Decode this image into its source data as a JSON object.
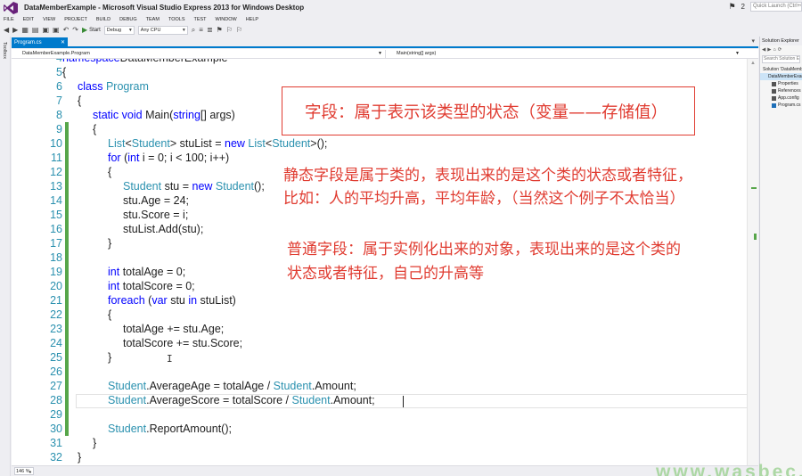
{
  "window": {
    "title": "DataMemberExample - Microsoft Visual Studio Express 2013 for Windows Desktop",
    "notifications": "2",
    "quick_launch_placeholder": "Quick Launch (Ctrl+Q)"
  },
  "menu": [
    "FILE",
    "EDIT",
    "VIEW",
    "PROJECT",
    "BUILD",
    "DEBUG",
    "TEAM",
    "TOOLS",
    "TEST",
    "WINDOW",
    "HELP"
  ],
  "toolbar": {
    "start_label": "Start",
    "config_value": "Debug",
    "platform_value": "Any CPU"
  },
  "toolbox_label": "Toolbox",
  "tab": {
    "label": "Program.cs",
    "pin": "⊧",
    "close": "✕"
  },
  "navbar": {
    "left": "DataMemberExample.Program",
    "right": "Main(string[] args)"
  },
  "code": [
    {
      "n": "4",
      "changed": false,
      "parts": [
        [
          "k",
          "namespace"
        ],
        [
          "",
          "DataMemberExample"
        ]
      ],
      "indent": 0
    },
    {
      "n": "5",
      "changed": false,
      "parts": [
        [
          "",
          "{"
        ]
      ],
      "indent": 0
    },
    {
      "n": "6",
      "changed": false,
      "parts": [
        [
          "k",
          "class "
        ],
        [
          "t",
          "Program"
        ]
      ],
      "indent": 1
    },
    {
      "n": "7",
      "changed": false,
      "parts": [
        [
          "",
          "{"
        ]
      ],
      "indent": 1
    },
    {
      "n": "8",
      "changed": false,
      "parts": [
        [
          "k",
          "static "
        ],
        [
          "k",
          "void "
        ],
        [
          "",
          "Main("
        ],
        [
          "k",
          "string"
        ],
        [
          "",
          "[] args)"
        ]
      ],
      "indent": 2
    },
    {
      "n": "9",
      "changed": true,
      "parts": [
        [
          "",
          "{"
        ]
      ],
      "indent": 2
    },
    {
      "n": "10",
      "changed": true,
      "parts": [
        [
          "t",
          "List"
        ],
        [
          "",
          "<"
        ],
        [
          "t",
          "Student"
        ],
        [
          "",
          "> stuList = "
        ],
        [
          "k",
          "new "
        ],
        [
          "t",
          "List"
        ],
        [
          "",
          "<"
        ],
        [
          "t",
          "Student"
        ],
        [
          "",
          ">();"
        ]
      ],
      "indent": 3
    },
    {
      "n": "11",
      "changed": true,
      "parts": [
        [
          "k",
          "for "
        ],
        [
          "",
          "("
        ],
        [
          "k",
          "int "
        ],
        [
          "",
          "i = 0; i < 100; i++)"
        ]
      ],
      "indent": 3
    },
    {
      "n": "12",
      "changed": true,
      "parts": [
        [
          "",
          "{"
        ]
      ],
      "indent": 3
    },
    {
      "n": "13",
      "changed": true,
      "parts": [
        [
          "t",
          "Student "
        ],
        [
          "",
          "stu = "
        ],
        [
          "k",
          "new "
        ],
        [
          "t",
          "Student"
        ],
        [
          "",
          "();"
        ]
      ],
      "indent": 4
    },
    {
      "n": "14",
      "changed": true,
      "parts": [
        [
          "",
          "stu.Age = 24;"
        ]
      ],
      "indent": 4
    },
    {
      "n": "15",
      "changed": true,
      "parts": [
        [
          "",
          "stu.Score = i;"
        ]
      ],
      "indent": 4
    },
    {
      "n": "16",
      "changed": true,
      "parts": [
        [
          "",
          "stuList.Add(stu);"
        ]
      ],
      "indent": 4
    },
    {
      "n": "17",
      "changed": true,
      "parts": [
        [
          "",
          "}"
        ]
      ],
      "indent": 3
    },
    {
      "n": "18",
      "changed": true,
      "parts": [],
      "indent": 3
    },
    {
      "n": "19",
      "changed": true,
      "parts": [
        [
          "k",
          "int "
        ],
        [
          "",
          "totalAge = 0;"
        ]
      ],
      "indent": 3
    },
    {
      "n": "20",
      "changed": true,
      "parts": [
        [
          "k",
          "int "
        ],
        [
          "",
          "totalScore = 0;"
        ]
      ],
      "indent": 3
    },
    {
      "n": "21",
      "changed": true,
      "parts": [
        [
          "k",
          "foreach "
        ],
        [
          "",
          "("
        ],
        [
          "k",
          "var "
        ],
        [
          "",
          "stu "
        ],
        [
          "k",
          "in "
        ],
        [
          "",
          "stuList)"
        ]
      ],
      "indent": 3
    },
    {
      "n": "22",
      "changed": true,
      "parts": [
        [
          "",
          "{"
        ]
      ],
      "indent": 3
    },
    {
      "n": "23",
      "changed": true,
      "parts": [
        [
          "",
          "totalAge += stu.Age;"
        ]
      ],
      "indent": 4
    },
    {
      "n": "24",
      "changed": true,
      "parts": [
        [
          "",
          "totalScore += stu.Score;"
        ]
      ],
      "indent": 4
    },
    {
      "n": "25",
      "changed": true,
      "parts": [
        [
          "",
          "}"
        ]
      ],
      "indent": 3
    },
    {
      "n": "26",
      "changed": true,
      "parts": [],
      "indent": 3
    },
    {
      "n": "27",
      "changed": true,
      "parts": [
        [
          "t",
          "Student"
        ],
        [
          "",
          ".AverageAge = totalAge / "
        ],
        [
          "t",
          "Student"
        ],
        [
          "",
          ".Amount;"
        ]
      ],
      "indent": 3
    },
    {
      "n": "28",
      "changed": true,
      "parts": [
        [
          "t",
          "Student"
        ],
        [
          "",
          ".AverageScore = totalScore / "
        ],
        [
          "t",
          "Student"
        ],
        [
          "",
          ".Amount;"
        ]
      ],
      "indent": 3
    },
    {
      "n": "29",
      "changed": true,
      "parts": [],
      "indent": 3
    },
    {
      "n": "30",
      "changed": true,
      "parts": [
        [
          "t",
          "Student"
        ],
        [
          "",
          ".ReportAmount();"
        ]
      ],
      "indent": 3
    },
    {
      "n": "31",
      "changed": false,
      "parts": [
        [
          "",
          "}"
        ]
      ],
      "indent": 2
    },
    {
      "n": "32",
      "changed": false,
      "parts": [
        [
          "",
          "}"
        ]
      ],
      "indent": 1
    }
  ],
  "annotations": {
    "box": "字段：属于表示该类型的状态（变量——存储值）",
    "static_line1": "静态字段是属于类的，表现出来的是这个类的状态或者特征，",
    "static_line2": "比如：人的平均升高，平均年龄，（当然这个例子不太恰当）",
    "instance_line1": "普通字段：属于实例化出来的对象，表现出来的是这个类的",
    "instance_line2": "状态或者特征，自己的升高等"
  },
  "zoom": "146 %",
  "solution_explorer": {
    "title": "Solution Explorer",
    "search_placeholder": "Search Solution Explorer (Ctrl+;)",
    "tree": [
      {
        "label": "Solution 'DataMemberExample'",
        "indent": 0,
        "selected": false
      },
      {
        "label": "DataMemberExample",
        "indent": 1,
        "selected": true
      },
      {
        "label": "Properties",
        "indent": 2,
        "selected": false
      },
      {
        "label": "References",
        "indent": 2,
        "selected": false
      },
      {
        "label": "App.config",
        "indent": 2,
        "selected": false
      },
      {
        "label": "Program.cs",
        "indent": 2,
        "selected": false
      }
    ]
  },
  "watermark": "www.wasbec.com",
  "colors": {
    "keyword": "#0000ff",
    "type": "#2b91af",
    "annotation": "#e03c31",
    "accent": "#007acc",
    "change_bar": "#57a64a"
  }
}
